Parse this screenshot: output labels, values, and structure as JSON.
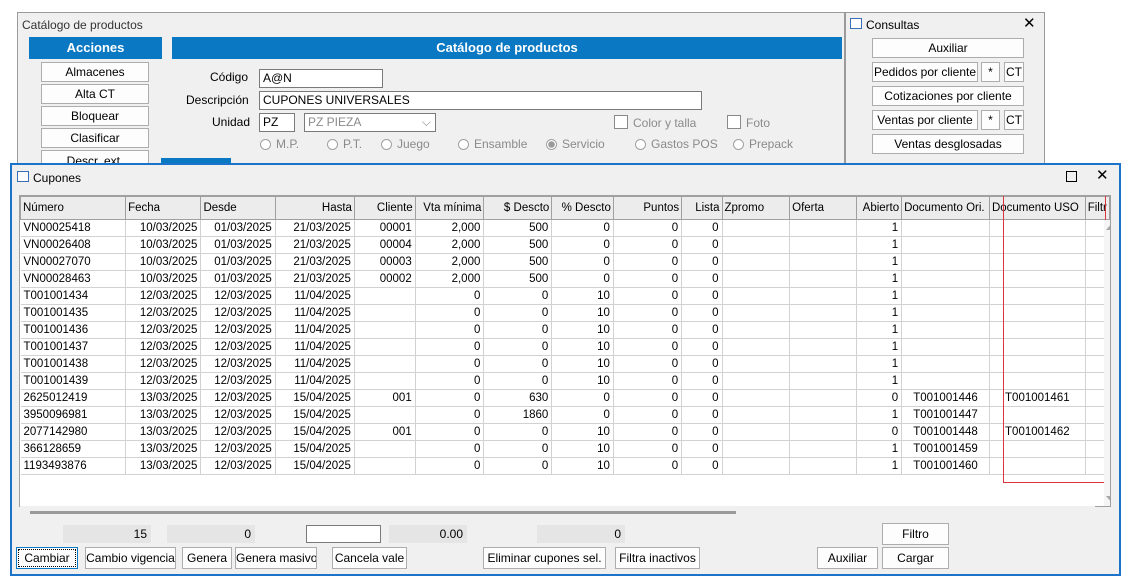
{
  "catalog": {
    "window_title": "Catálogo de productos",
    "actions_header": "Acciones",
    "actions": [
      "Almacenes",
      "Alta CT",
      "Bloquear",
      "Clasificar",
      "Descr. ext."
    ],
    "form_header": "Catálogo de productos",
    "code_label": "Código",
    "code_value": "A@N",
    "desc_label": "Descripción",
    "desc_value": "CUPONES UNIVERSALES",
    "unit_label": "Unidad",
    "unit_value": "PZ",
    "unit_select": "PZ  PIEZA",
    "color_talla": "Color y talla",
    "foto": "Foto",
    "radios": [
      "M.P.",
      "P.T.",
      "Juego",
      "Ensamble",
      "Servicio",
      "Gastos POS",
      "Prepack"
    ],
    "radio_selected": "Servicio"
  },
  "consultas": {
    "title": "Consultas",
    "auxiliar": "Auxiliar",
    "pedidos": "Pedidos por cliente",
    "cotizaciones": "Cotizaciones por cliente",
    "ventas": "Ventas por cliente",
    "star": "*",
    "ct": "CT",
    "desglosadas": "Ventas desglosadas"
  },
  "cupones": {
    "title": "Cupones",
    "columns": [
      "Número",
      "Fecha",
      "Desde",
      "Hasta",
      "Cliente",
      "Vta mínima",
      "$ Descto",
      "% Descto",
      "Puntos",
      "Lista",
      "Zpromo",
      "Oferta",
      "Abierto",
      "Documento Ori.",
      "Documento USO",
      "Filtr"
    ],
    "rows": [
      [
        "VN00025418",
        "10/03/2025",
        "01/03/2025",
        "21/03/2025",
        "00001",
        "2,000",
        "500",
        "0",
        "0",
        "0",
        "",
        "",
        "1",
        "",
        ""
      ],
      [
        "VN00026408",
        "10/03/2025",
        "01/03/2025",
        "21/03/2025",
        "00004",
        "2,000",
        "500",
        "0",
        "0",
        "0",
        "",
        "",
        "1",
        "",
        ""
      ],
      [
        "VN00027070",
        "10/03/2025",
        "01/03/2025",
        "21/03/2025",
        "00003",
        "2,000",
        "500",
        "0",
        "0",
        "0",
        "",
        "",
        "1",
        "",
        ""
      ],
      [
        "VN00028463",
        "10/03/2025",
        "01/03/2025",
        "21/03/2025",
        "00002",
        "2,000",
        "500",
        "0",
        "0",
        "0",
        "",
        "",
        "1",
        "",
        ""
      ],
      [
        "T001001434",
        "12/03/2025",
        "12/03/2025",
        "11/04/2025",
        "",
        "0",
        "0",
        "10",
        "0",
        "0",
        "",
        "",
        "1",
        "",
        ""
      ],
      [
        "T001001435",
        "12/03/2025",
        "12/03/2025",
        "11/04/2025",
        "",
        "0",
        "0",
        "10",
        "0",
        "0",
        "",
        "",
        "1",
        "",
        ""
      ],
      [
        "T001001436",
        "12/03/2025",
        "12/03/2025",
        "11/04/2025",
        "",
        "0",
        "0",
        "10",
        "0",
        "0",
        "",
        "",
        "1",
        "",
        ""
      ],
      [
        "T001001437",
        "12/03/2025",
        "12/03/2025",
        "11/04/2025",
        "",
        "0",
        "0",
        "10",
        "0",
        "0",
        "",
        "",
        "1",
        "",
        ""
      ],
      [
        "T001001438",
        "12/03/2025",
        "12/03/2025",
        "11/04/2025",
        "",
        "0",
        "0",
        "10",
        "0",
        "0",
        "",
        "",
        "1",
        "",
        ""
      ],
      [
        "T001001439",
        "12/03/2025",
        "12/03/2025",
        "11/04/2025",
        "",
        "0",
        "0",
        "10",
        "0",
        "0",
        "",
        "",
        "1",
        "",
        ""
      ],
      [
        "2625012419",
        "13/03/2025",
        "12/03/2025",
        "15/04/2025",
        "001",
        "0",
        "630",
        "0",
        "0",
        "0",
        "",
        "",
        "0",
        "T001001446",
        "T001001461"
      ],
      [
        "3950096981",
        "13/03/2025",
        "12/03/2025",
        "15/04/2025",
        "",
        "0",
        "1860",
        "0",
        "0",
        "0",
        "",
        "",
        "1",
        "T001001447",
        ""
      ],
      [
        "2077142980",
        "13/03/2025",
        "12/03/2025",
        "15/04/2025",
        "001",
        "0",
        "0",
        "10",
        "0",
        "0",
        "",
        "",
        "0",
        "T001001448",
        "T001001462"
      ],
      [
        "366128659",
        "13/03/2025",
        "12/03/2025",
        "15/04/2025",
        "",
        "0",
        "0",
        "10",
        "0",
        "0",
        "",
        "",
        "1",
        "T001001459",
        ""
      ],
      [
        "1193493876",
        "13/03/2025",
        "12/03/2025",
        "15/04/2025",
        "",
        "0",
        "0",
        "10",
        "0",
        "0",
        "",
        "",
        "1",
        "T001001460",
        ""
      ]
    ],
    "totals": {
      "count": "15",
      "t1": "0",
      "t2": "",
      "t3": "0.00",
      "t4": "0"
    },
    "buttons": {
      "cambiar": "Cambiar",
      "cambio_vigencia": "Cambio vigencia",
      "genera": "Genera",
      "genera_masivo": "Genera masivo",
      "cancela_vale": "Cancela vale",
      "eliminar": "Eliminar cupones sel.",
      "filtra_inactivos": "Filtra inactivos",
      "auxiliar": "Auxiliar",
      "filtro": "Filtro",
      "cargar": "Cargar"
    },
    "colors": {
      "accent": "#0a78c2",
      "highlight": "#d9363e"
    }
  }
}
